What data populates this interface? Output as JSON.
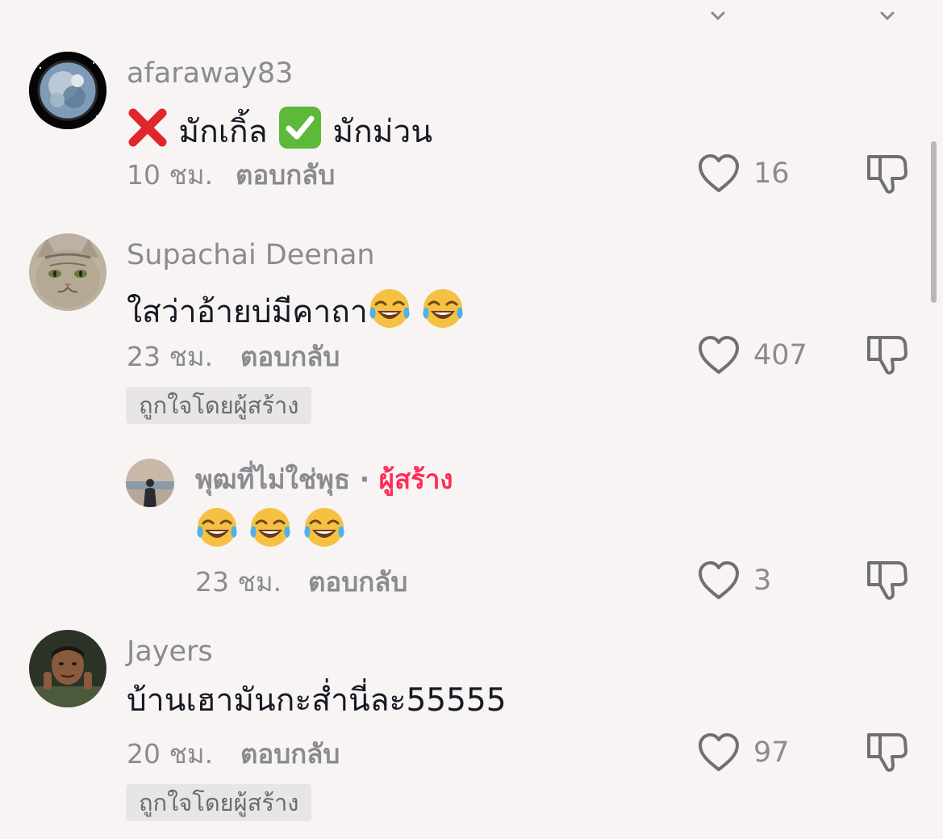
{
  "comments": [
    {
      "username": "afaraway83",
      "text_part1": "มักเกิ้ล",
      "text_part2": "มักม่วน",
      "emoji_1": "cross-mark-emoji",
      "emoji_2": "check-mark-emoji",
      "time": "10 ชม.",
      "reply_label": "ตอบกลับ",
      "likes": "16"
    },
    {
      "username": "Supachai Deenan",
      "text": "ใสว่าอ้ายบ่มีคาถา",
      "emojis": [
        "face-with-tears-of-joy",
        "face-with-tears-of-joy"
      ],
      "time": "23 ชม.",
      "reply_label": "ตอบกลับ",
      "likes": "407",
      "creator_liked_badge": "ถูกใจโดยผู้สร้าง",
      "replies": [
        {
          "username": "พุฒที่ไม่ใช่พุธ",
          "separator": "·",
          "creator_tag": "ผู้สร้าง",
          "emojis": [
            "face-with-tears-of-joy",
            "face-with-tears-of-joy",
            "face-with-tears-of-joy"
          ],
          "time": "23 ชม.",
          "reply_label": "ตอบกลับ",
          "likes": "3"
        }
      ]
    },
    {
      "username": "Jayers",
      "text": "บ้านเฮามันกะส่ำนี่ละ55555",
      "time": "20 ชม.",
      "reply_label": "ตอบกลับ",
      "likes": "97",
      "creator_liked_badge": "ถูกใจโดยผู้สร้าง"
    }
  ],
  "icons": {
    "like": "heart-outline-icon",
    "dislike": "thumbs-down-outline-icon"
  },
  "colors": {
    "background": "#f8f4f4",
    "text_primary": "#161823",
    "text_secondary": "#8a8b91",
    "creator_tag": "#fe2c55",
    "badge_bg": "#e8e5e5"
  }
}
